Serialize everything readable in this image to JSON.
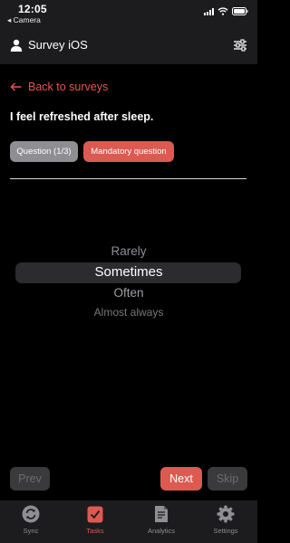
{
  "status_bar": {
    "time": "12:05",
    "back_app": "◂ Camera"
  },
  "nav": {
    "title": "Survey iOS",
    "user_icon": "person-icon",
    "filter_icon": "sliders-icon"
  },
  "back": {
    "label": "Back to surveys",
    "icon": "arrow-left-icon"
  },
  "question": {
    "text": "I feel refreshed after sleep."
  },
  "badges": {
    "progress": "Question (1/3)",
    "mandatory": "Mandatory question"
  },
  "picker": {
    "options": [
      "Rarely",
      "Sometimes",
      "Often",
      "Almost always"
    ],
    "selected": "Sometimes"
  },
  "buttons": {
    "prev": "Prev",
    "next": "Next",
    "skip": "Skip"
  },
  "tabs": [
    {
      "label": "Sync",
      "icon": "sync-icon"
    },
    {
      "label": "Tasks",
      "icon": "tasks-check-icon",
      "active": true
    },
    {
      "label": "Analytics",
      "icon": "document-icon"
    },
    {
      "label": "Settings",
      "icon": "gear-icon"
    }
  ],
  "colors": {
    "accent": "#dc5a51",
    "background": "#000000",
    "bar": "#1c1c1e"
  }
}
